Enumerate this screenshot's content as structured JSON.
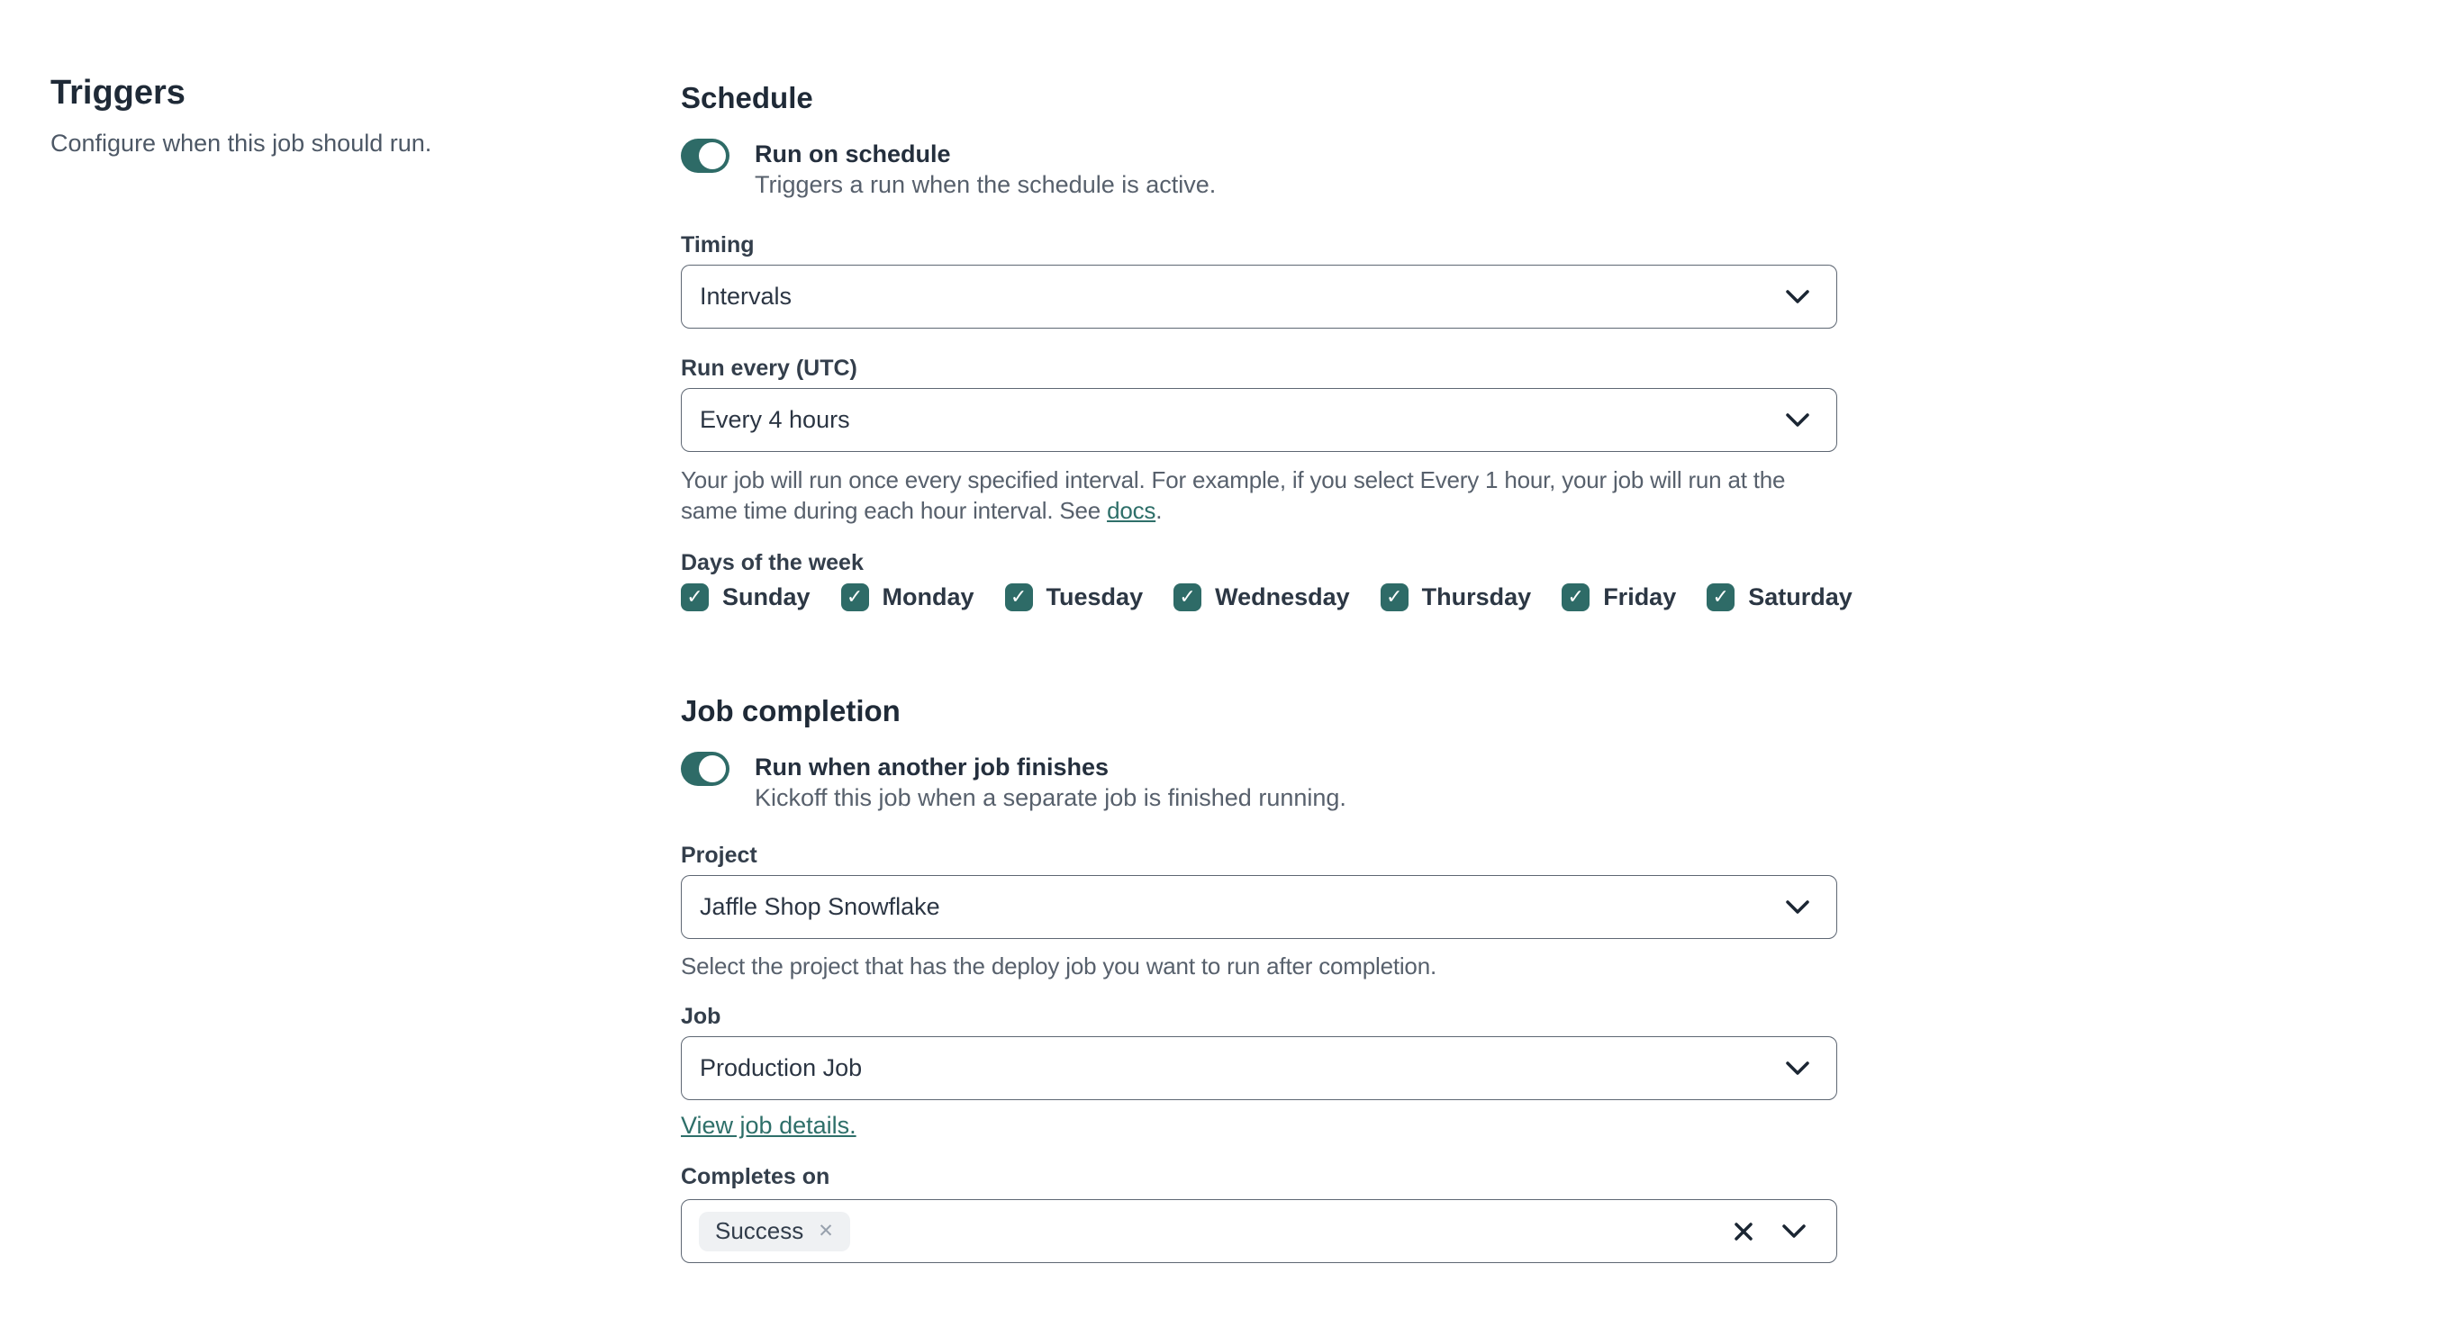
{
  "left": {
    "title": "Triggers",
    "subtitle": "Configure when this job should run."
  },
  "schedule": {
    "heading": "Schedule",
    "toggle": {
      "state": "on",
      "label": "Run on schedule",
      "description": "Triggers a run when the schedule is active."
    },
    "timing": {
      "label": "Timing",
      "value": "Intervals"
    },
    "run_every": {
      "label": "Run every (UTC)",
      "value": "Every 4 hours"
    },
    "interval_help": {
      "before": "Your job will run once every specified interval. For example, if you select Every 1 hour, your job will run at the same time during each hour interval. See ",
      "link": "docs",
      "after": "."
    },
    "days": {
      "label": "Days of the week",
      "items": [
        {
          "label": "Sunday",
          "checked": true
        },
        {
          "label": "Monday",
          "checked": true
        },
        {
          "label": "Tuesday",
          "checked": true
        },
        {
          "label": "Wednesday",
          "checked": true
        },
        {
          "label": "Thursday",
          "checked": true
        },
        {
          "label": "Friday",
          "checked": true
        },
        {
          "label": "Saturday",
          "checked": true
        }
      ],
      "check_glyph": "✓"
    }
  },
  "job_completion": {
    "heading": "Job completion",
    "toggle": {
      "state": "on",
      "label": "Run when another job finishes",
      "description": "Kickoff this job when a separate job is finished running."
    },
    "project": {
      "label": "Project",
      "value": "Jaffle Shop Snowflake",
      "help": "Select the project that has the deploy job you want to run after completion."
    },
    "job": {
      "label": "Job",
      "value": "Production Job",
      "link": "View job details."
    },
    "completes_on": {
      "label": "Completes on",
      "tags": [
        {
          "label": "Success",
          "remove_glyph": "✕"
        }
      ]
    }
  },
  "colors": {
    "teal": "#2e6b67",
    "heading": "#1f2a37",
    "body_gray": "#57606c",
    "border": "#5e6773",
    "link": "#2e6f69",
    "tag_bg": "#eff1f3"
  }
}
